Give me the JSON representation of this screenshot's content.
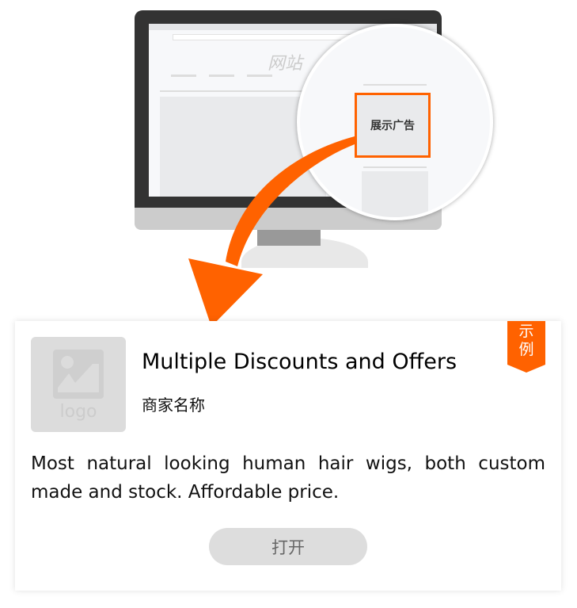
{
  "illustration": {
    "site_label": "网站",
    "ad_label": "展示广告",
    "accent_color": "#ff6200"
  },
  "ad_card": {
    "logo_text": "logo",
    "title": "Multiple Discounts and Offers",
    "merchant": "商家名称",
    "description": "Most natural looking human hair wigs, both custom made and stock. Affordable price.",
    "button_label": "打开",
    "badge": "示例"
  }
}
